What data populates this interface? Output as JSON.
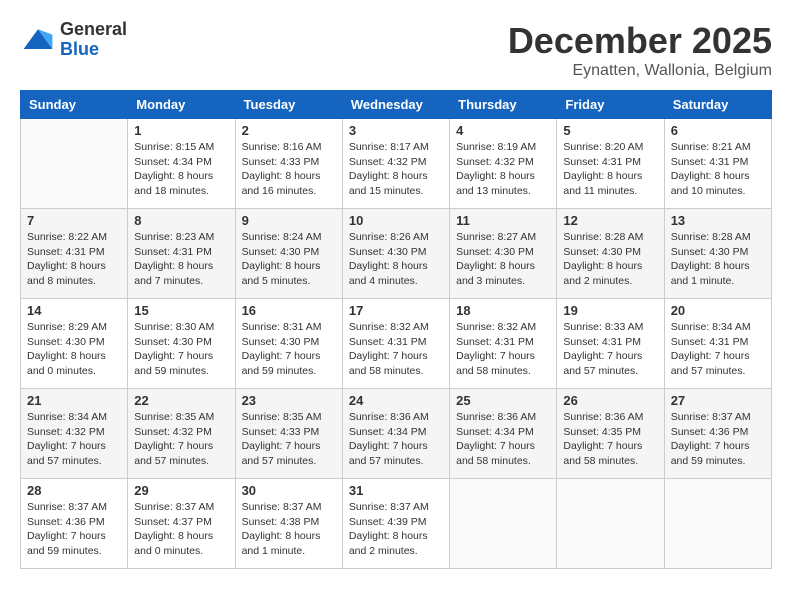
{
  "header": {
    "logo_general": "General",
    "logo_blue": "Blue",
    "month_title": "December 2025",
    "location": "Eynatten, Wallonia, Belgium"
  },
  "days_of_week": [
    "Sunday",
    "Monday",
    "Tuesday",
    "Wednesday",
    "Thursday",
    "Friday",
    "Saturday"
  ],
  "weeks": [
    {
      "shade": "white",
      "days": [
        {
          "num": "",
          "sunrise": "",
          "sunset": "",
          "daylight": ""
        },
        {
          "num": "1",
          "sunrise": "Sunrise: 8:15 AM",
          "sunset": "Sunset: 4:34 PM",
          "daylight": "Daylight: 8 hours and 18 minutes."
        },
        {
          "num": "2",
          "sunrise": "Sunrise: 8:16 AM",
          "sunset": "Sunset: 4:33 PM",
          "daylight": "Daylight: 8 hours and 16 minutes."
        },
        {
          "num": "3",
          "sunrise": "Sunrise: 8:17 AM",
          "sunset": "Sunset: 4:32 PM",
          "daylight": "Daylight: 8 hours and 15 minutes."
        },
        {
          "num": "4",
          "sunrise": "Sunrise: 8:19 AM",
          "sunset": "Sunset: 4:32 PM",
          "daylight": "Daylight: 8 hours and 13 minutes."
        },
        {
          "num": "5",
          "sunrise": "Sunrise: 8:20 AM",
          "sunset": "Sunset: 4:31 PM",
          "daylight": "Daylight: 8 hours and 11 minutes."
        },
        {
          "num": "6",
          "sunrise": "Sunrise: 8:21 AM",
          "sunset": "Sunset: 4:31 PM",
          "daylight": "Daylight: 8 hours and 10 minutes."
        }
      ]
    },
    {
      "shade": "shade",
      "days": [
        {
          "num": "7",
          "sunrise": "Sunrise: 8:22 AM",
          "sunset": "Sunset: 4:31 PM",
          "daylight": "Daylight: 8 hours and 8 minutes."
        },
        {
          "num": "8",
          "sunrise": "Sunrise: 8:23 AM",
          "sunset": "Sunset: 4:31 PM",
          "daylight": "Daylight: 8 hours and 7 minutes."
        },
        {
          "num": "9",
          "sunrise": "Sunrise: 8:24 AM",
          "sunset": "Sunset: 4:30 PM",
          "daylight": "Daylight: 8 hours and 5 minutes."
        },
        {
          "num": "10",
          "sunrise": "Sunrise: 8:26 AM",
          "sunset": "Sunset: 4:30 PM",
          "daylight": "Daylight: 8 hours and 4 minutes."
        },
        {
          "num": "11",
          "sunrise": "Sunrise: 8:27 AM",
          "sunset": "Sunset: 4:30 PM",
          "daylight": "Daylight: 8 hours and 3 minutes."
        },
        {
          "num": "12",
          "sunrise": "Sunrise: 8:28 AM",
          "sunset": "Sunset: 4:30 PM",
          "daylight": "Daylight: 8 hours and 2 minutes."
        },
        {
          "num": "13",
          "sunrise": "Sunrise: 8:28 AM",
          "sunset": "Sunset: 4:30 PM",
          "daylight": "Daylight: 8 hours and 1 minute."
        }
      ]
    },
    {
      "shade": "white",
      "days": [
        {
          "num": "14",
          "sunrise": "Sunrise: 8:29 AM",
          "sunset": "Sunset: 4:30 PM",
          "daylight": "Daylight: 8 hours and 0 minutes."
        },
        {
          "num": "15",
          "sunrise": "Sunrise: 8:30 AM",
          "sunset": "Sunset: 4:30 PM",
          "daylight": "Daylight: 7 hours and 59 minutes."
        },
        {
          "num": "16",
          "sunrise": "Sunrise: 8:31 AM",
          "sunset": "Sunset: 4:30 PM",
          "daylight": "Daylight: 7 hours and 59 minutes."
        },
        {
          "num": "17",
          "sunrise": "Sunrise: 8:32 AM",
          "sunset": "Sunset: 4:31 PM",
          "daylight": "Daylight: 7 hours and 58 minutes."
        },
        {
          "num": "18",
          "sunrise": "Sunrise: 8:32 AM",
          "sunset": "Sunset: 4:31 PM",
          "daylight": "Daylight: 7 hours and 58 minutes."
        },
        {
          "num": "19",
          "sunrise": "Sunrise: 8:33 AM",
          "sunset": "Sunset: 4:31 PM",
          "daylight": "Daylight: 7 hours and 57 minutes."
        },
        {
          "num": "20",
          "sunrise": "Sunrise: 8:34 AM",
          "sunset": "Sunset: 4:31 PM",
          "daylight": "Daylight: 7 hours and 57 minutes."
        }
      ]
    },
    {
      "shade": "shade",
      "days": [
        {
          "num": "21",
          "sunrise": "Sunrise: 8:34 AM",
          "sunset": "Sunset: 4:32 PM",
          "daylight": "Daylight: 7 hours and 57 minutes."
        },
        {
          "num": "22",
          "sunrise": "Sunrise: 8:35 AM",
          "sunset": "Sunset: 4:32 PM",
          "daylight": "Daylight: 7 hours and 57 minutes."
        },
        {
          "num": "23",
          "sunrise": "Sunrise: 8:35 AM",
          "sunset": "Sunset: 4:33 PM",
          "daylight": "Daylight: 7 hours and 57 minutes."
        },
        {
          "num": "24",
          "sunrise": "Sunrise: 8:36 AM",
          "sunset": "Sunset: 4:34 PM",
          "daylight": "Daylight: 7 hours and 57 minutes."
        },
        {
          "num": "25",
          "sunrise": "Sunrise: 8:36 AM",
          "sunset": "Sunset: 4:34 PM",
          "daylight": "Daylight: 7 hours and 58 minutes."
        },
        {
          "num": "26",
          "sunrise": "Sunrise: 8:36 AM",
          "sunset": "Sunset: 4:35 PM",
          "daylight": "Daylight: 7 hours and 58 minutes."
        },
        {
          "num": "27",
          "sunrise": "Sunrise: 8:37 AM",
          "sunset": "Sunset: 4:36 PM",
          "daylight": "Daylight: 7 hours and 59 minutes."
        }
      ]
    },
    {
      "shade": "white",
      "days": [
        {
          "num": "28",
          "sunrise": "Sunrise: 8:37 AM",
          "sunset": "Sunset: 4:36 PM",
          "daylight": "Daylight: 7 hours and 59 minutes."
        },
        {
          "num": "29",
          "sunrise": "Sunrise: 8:37 AM",
          "sunset": "Sunset: 4:37 PM",
          "daylight": "Daylight: 8 hours and 0 minutes."
        },
        {
          "num": "30",
          "sunrise": "Sunrise: 8:37 AM",
          "sunset": "Sunset: 4:38 PM",
          "daylight": "Daylight: 8 hours and 1 minute."
        },
        {
          "num": "31",
          "sunrise": "Sunrise: 8:37 AM",
          "sunset": "Sunset: 4:39 PM",
          "daylight": "Daylight: 8 hours and 2 minutes."
        },
        {
          "num": "",
          "sunrise": "",
          "sunset": "",
          "daylight": ""
        },
        {
          "num": "",
          "sunrise": "",
          "sunset": "",
          "daylight": ""
        },
        {
          "num": "",
          "sunrise": "",
          "sunset": "",
          "daylight": ""
        }
      ]
    }
  ]
}
